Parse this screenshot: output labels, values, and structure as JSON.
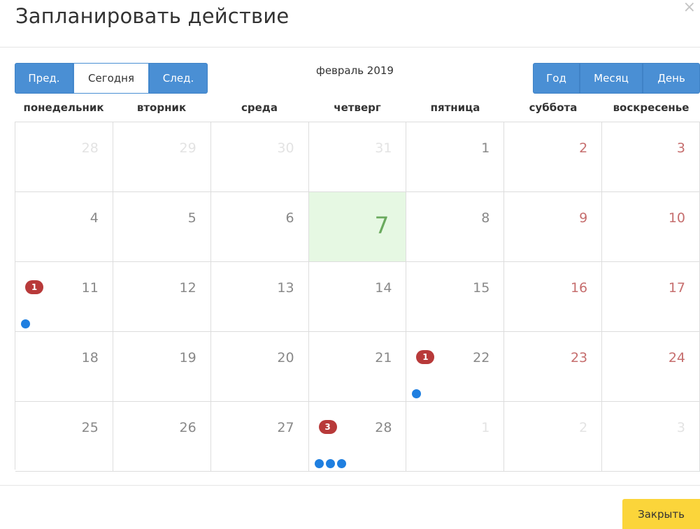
{
  "modal": {
    "title": "Запланировать действие",
    "close_icon": "×",
    "close_button": "Закрыть"
  },
  "toolbar": {
    "prev": "Пред.",
    "today": "Сегодня",
    "next": "След.",
    "month_label": "февраль 2019",
    "view_year": "Год",
    "view_month": "Месяц",
    "view_day": "День"
  },
  "weekdays": [
    "понедельник",
    "вторник",
    "среда",
    "четверг",
    "пятница",
    "суббота",
    "воскресенье"
  ],
  "colors": {
    "primary": "#4a8fd4",
    "today_bg": "#e6f8e3",
    "today_text": "#6aaa5e",
    "weekend_text": "#c66e6e",
    "badge": "#b83a3a",
    "event_dot": "#1f7fe0",
    "close_button": "#fbd53a"
  },
  "weeks": [
    [
      {
        "day": "28",
        "other": true
      },
      {
        "day": "29",
        "other": true
      },
      {
        "day": "30",
        "other": true
      },
      {
        "day": "31",
        "other": true
      },
      {
        "day": "1"
      },
      {
        "day": "2",
        "weekend": true
      },
      {
        "day": "3",
        "weekend": true
      }
    ],
    [
      {
        "day": "4"
      },
      {
        "day": "5"
      },
      {
        "day": "6"
      },
      {
        "day": "7",
        "today": true
      },
      {
        "day": "8"
      },
      {
        "day": "9",
        "weekend": true
      },
      {
        "day": "10",
        "weekend": true
      }
    ],
    [
      {
        "day": "11",
        "badge": "1",
        "dots": 1
      },
      {
        "day": "12"
      },
      {
        "day": "13"
      },
      {
        "day": "14"
      },
      {
        "day": "15"
      },
      {
        "day": "16",
        "weekend": true
      },
      {
        "day": "17",
        "weekend": true
      }
    ],
    [
      {
        "day": "18"
      },
      {
        "day": "19"
      },
      {
        "day": "20"
      },
      {
        "day": "21"
      },
      {
        "day": "22",
        "badge": "1",
        "dots": 1
      },
      {
        "day": "23",
        "weekend": true
      },
      {
        "day": "24",
        "weekend": true
      }
    ],
    [
      {
        "day": "25"
      },
      {
        "day": "26"
      },
      {
        "day": "27"
      },
      {
        "day": "28",
        "badge": "3",
        "dots": 3
      },
      {
        "day": "1",
        "other": true
      },
      {
        "day": "2",
        "other": true
      },
      {
        "day": "3",
        "other": true
      }
    ]
  ]
}
